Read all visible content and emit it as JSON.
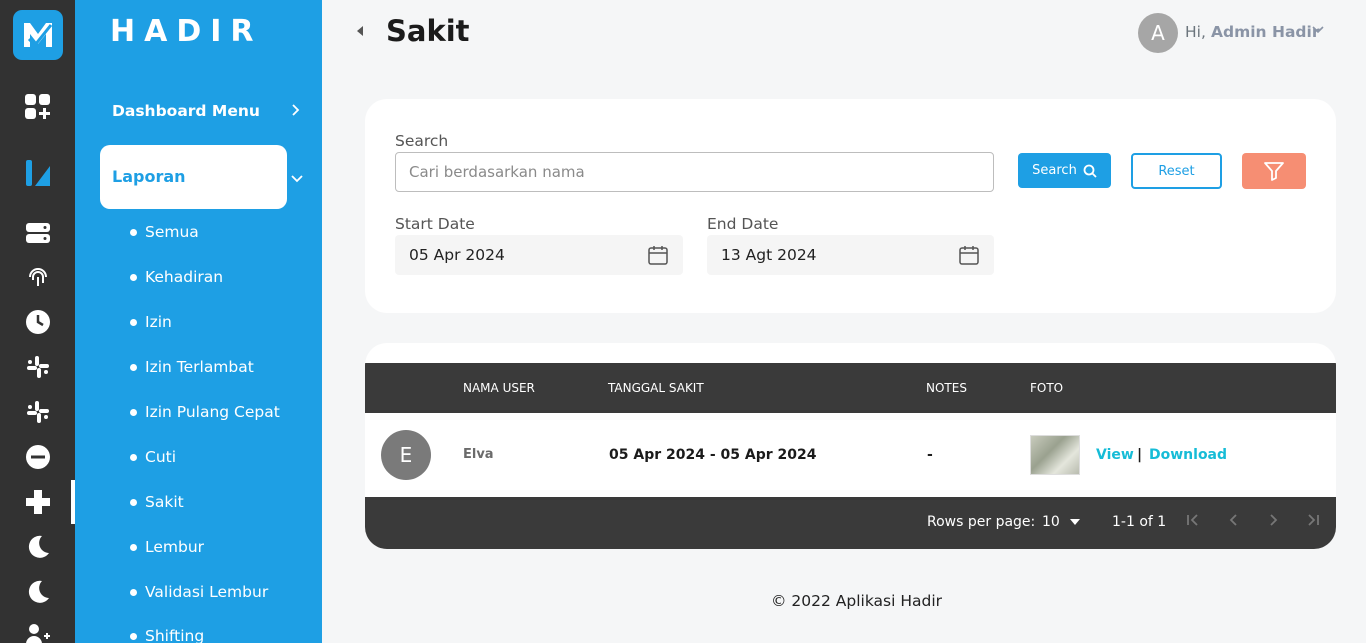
{
  "brand": "HADIR",
  "rail": {
    "icons": [
      "app-logo-icon",
      "add-widget-icon",
      "brand-icon",
      "server-icon",
      "fingerprint-icon",
      "clock-icon",
      "slack-icon",
      "slack-icon",
      "minus-circle-icon",
      "plus-icon",
      "moon-icon",
      "moon-icon",
      "user-swap-icon"
    ]
  },
  "sidebar": {
    "dashboard_label": "Dashboard Menu",
    "laporan_label": "Laporan",
    "sub_items": [
      "Semua",
      "Kehadiran",
      "Izin",
      "Izin Terlambat",
      "Izin Pulang Cepat",
      "Cuti",
      "Sakit",
      "Lembur",
      "Validasi Lembur",
      "Shifting"
    ],
    "active_item": "Sakit"
  },
  "header": {
    "title": "Sakit",
    "avatar_initial": "A",
    "greeting": "Hi,",
    "user_name": "Admin Hadir"
  },
  "filter": {
    "search_label": "Search",
    "search_placeholder": "Cari berdasarkan nama",
    "search_value": "",
    "search_button": "Search",
    "reset_button": "Reset",
    "start_date_label": "Start Date",
    "start_date_value": "05 Apr 2024",
    "end_date_label": "End Date",
    "end_date_value": "13 Agt 2024"
  },
  "table": {
    "columns": [
      "NAMA USER",
      "TANGGAL SAKIT",
      "NOTES",
      "FOTO"
    ],
    "rows": [
      {
        "avatar_initial": "E",
        "nama_user": "Elva",
        "tanggal_sakit": "05 Apr 2024 - 05 Apr 2024",
        "notes": "-",
        "view_label": "View",
        "separator": "|",
        "download_label": "Download"
      }
    ],
    "rows_per_page_label": "Rows per page:",
    "rows_per_page_value": "10",
    "range_text": "1-1 of 1"
  },
  "colors": {
    "primary": "#1e9fe4",
    "rail": "#323232",
    "filter_button": "#f68e73",
    "link": "#16bcd7",
    "table_header": "#3a3a3a"
  },
  "footer": "© 2022 Aplikasi Hadir"
}
